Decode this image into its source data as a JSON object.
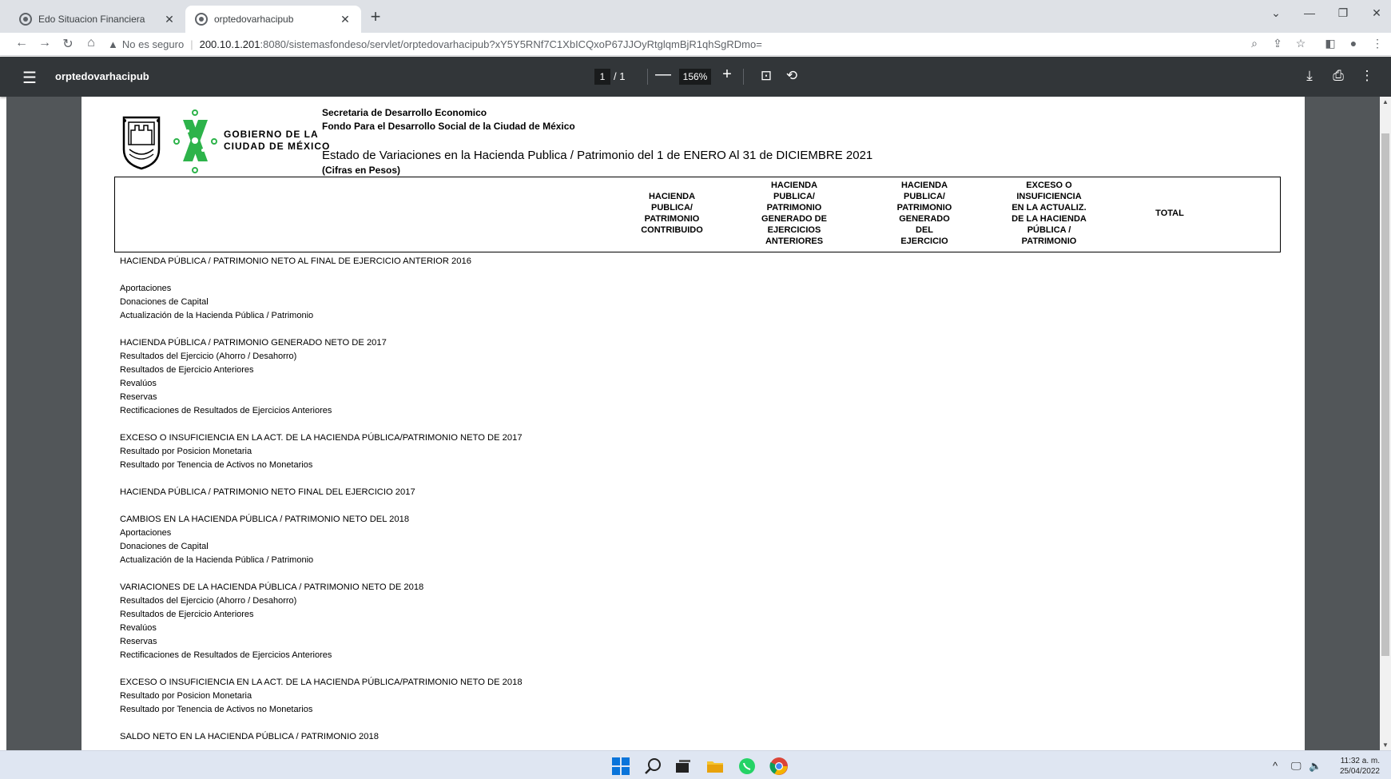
{
  "browser": {
    "tabs": [
      {
        "label": "Edo Situacion Financiera",
        "close": "✕"
      },
      {
        "label": "orptedovarhacipub",
        "close": "✕"
      }
    ],
    "new_tab": "+",
    "address": {
      "security_label": "No es seguro",
      "host": "200.10.1.201",
      "path": ":8080/sistemasfondeso/servlet/orptedovarhacipub?xY5Y5RNf7C1XbICQxoP67JJOyRtglqmBjR1qhSgRDmo="
    }
  },
  "pdf_toolbar": {
    "title": "orptedovarhacipub",
    "page_current": "1",
    "page_total": "/ 1",
    "zoom": "156%",
    "zoom_out": "—",
    "zoom_in": "+"
  },
  "document": {
    "gobierno_line1": "GOBIERNO DE LA",
    "gobierno_line2": "CIUDAD DE MÉXICO",
    "header_line1": "Secretaria de Desarrollo Economico",
    "header_line2": "Fondo Para el Desarrollo Social de la Ciudad de México",
    "title": "Estado de Variaciones en la Hacienda Publica / Patrimonio del 1 de ENERO Al 31 de DICIEMBRE 2021",
    "subtitle": "(Cifras en Pesos)",
    "columns": [
      "HACIENDA\nPUBLICA/\nPATRIMONIO\nCONTRIBUIDO",
      "HACIENDA\nPUBLICA/\nPATRIMONIO\nGENERADO DE\nEJERCICIOS\nANTERIORES",
      "HACIENDA\nPUBLICA/\nPATRIMONIO\nGENERADO\nDEL\nEJERCICIO",
      "EXCESO O\nINSUFICIENCIA\nEN LA ACTUALIZ.\nDE LA HACIENDA\nPÚBLICA /\nPATRIMONIO",
      "TOTAL"
    ],
    "rows": [
      "HACIENDA PÚBLICA / PATRIMONIO NETO AL FINAL DE EJERCICIO ANTERIOR 2016",
      "",
      "Aportaciones",
      "Donaciones de Capital",
      "Actualización de la Hacienda Pública / Patrimonio",
      "",
      "HACIENDA PÚBLICA / PATRIMONIO GENERADO NETO DE 2017",
      "Resultados del Ejercicio (Ahorro / Desahorro)",
      "Resultados de Ejercicio Anteriores",
      "Revalúos",
      "Reservas",
      "Rectificaciones de Resultados de Ejercicios Anteriores",
      "",
      "EXCESO O INSUFICIENCIA EN LA ACT. DE LA HACIENDA PÚBLICA/PATRIMONIO NETO DE 2017",
      "Resultado por Posicion Monetaria",
      "Resultado por Tenencia de Activos no Monetarios",
      "",
      "HACIENDA PÚBLICA / PATRIMONIO NETO  FINAL DEL EJERCICIO 2017",
      "",
      "CAMBIOS EN LA HACIENDA PÚBLICA / PATRIMONIO NETO DEL  2018",
      "Aportaciones",
      "Donaciones de Capital",
      "Actualización de la Hacienda Pública / Patrimonio",
      "",
      "VARIACIONES DE LA HACIENDA PÚBLICA / PATRIMONIO NETO DE 2018",
      "Resultados del Ejercicio (Ahorro / Desahorro)",
      "Resultados de Ejercicio Anteriores",
      "Revalúos",
      "Reservas",
      "Rectificaciones de Resultados de Ejercicios Anteriores",
      "",
      "EXCESO O INSUFICIENCIA EN LA ACT. DE LA HACIENDA PÚBLICA/PATRIMONIO NETO DE 2018",
      "Resultado por Posicion Monetaria",
      "Resultado por Tenencia de Activos no Monetarios",
      "",
      "SALDO NETO EN LA HACIENDA PÚBLICA / PATRIMONIO 2018"
    ]
  },
  "taskbar": {
    "time": "11:32 a. m.",
    "date": "25/04/2022"
  },
  "colors": {
    "pdf_toolbar": "#323639",
    "viewer_bg": "#525659",
    "cdmx_green": "#2db34a"
  }
}
